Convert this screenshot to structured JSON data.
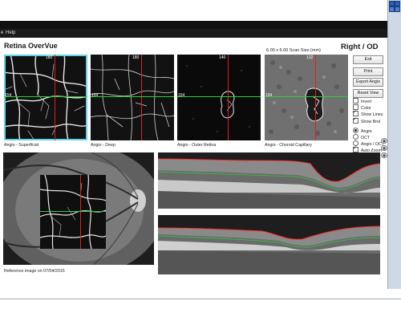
{
  "window": {
    "title": "Retina OverVue",
    "eye": "Right / OD"
  },
  "menu": {
    "items": [
      "e",
      "Help"
    ]
  },
  "scan": {
    "size_label": "6.00 x 6.00 Scan Size (mm)"
  },
  "thumbnails": [
    {
      "label": "Angio - Superficial",
      "top_marker": "180",
      "side_marker": "154"
    },
    {
      "label": "Angio - Deep",
      "top_marker": "180",
      "side_marker": "154"
    },
    {
      "label": "Angio - Outer Retina",
      "top_marker": "140",
      "side_marker": "154"
    },
    {
      "label": "Angio - Choroid Capillary",
      "top_marker": "132",
      "side_marker": "154"
    }
  ],
  "buttons": [
    "Exit",
    "Print",
    "Export Angio",
    "Reset View"
  ],
  "checkboxes": [
    {
      "label": "Invert",
      "checked": false
    },
    {
      "label": "Color",
      "checked": false
    },
    {
      "label": "Show Lines",
      "checked": true
    },
    {
      "label": "Show Bnd",
      "checked": true
    }
  ],
  "radios": [
    {
      "label": "Angio",
      "checked": true
    },
    {
      "label": "OCT",
      "checked": false
    },
    {
      "label": "Angio / OCT",
      "checked": false
    }
  ],
  "auto_zoom": {
    "label": "Auto Zoom",
    "checked": true
  },
  "reference": {
    "label": "Reference image on 07/04/2016"
  },
  "colors": {
    "selection": "#5fd3e8",
    "horizontal_line": "#2ecc40",
    "vertical_line": "#e02020",
    "ilm_line": "#ff3030"
  }
}
